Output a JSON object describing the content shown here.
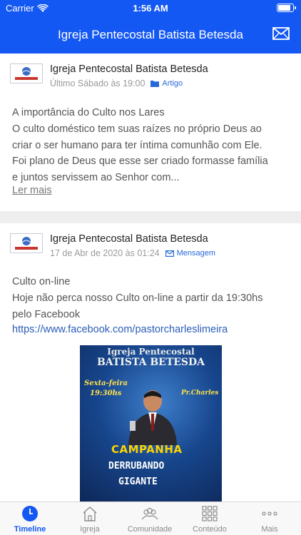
{
  "status_bar": {
    "carrier": "Carrier",
    "time": "1:56 AM",
    "battery_level": 0.9
  },
  "nav": {
    "title": "Igreja Pentecostal Batista Betesda",
    "mail_icon": "mail-icon"
  },
  "colors": {
    "brand": "#1458f3",
    "link": "#2a5db8",
    "tag": "#2768d8",
    "poster_yellow": "#ffd400"
  },
  "posts": [
    {
      "author": "Igreja Pentecostal Batista Betesda",
      "date": "Último Sábado às 19:00",
      "tag": "Artigo",
      "tag_icon": "folder-icon",
      "title": "A importância do Culto nos Lares",
      "lines": [
        "O culto doméstico tem suas raízes no próprio Deus ao",
        "criar o ser humano para ter íntima comunhão com Ele.",
        "Foi plano de Deus que esse ser criado formasse família",
        "e juntos servissem ao Senhor com..."
      ],
      "read_more": "Ler mais"
    },
    {
      "author": "Igreja Pentecostal Batista Betesda",
      "date": "17 de Abr de 2020 às 01:24",
      "tag": "Mensagem",
      "tag_icon": "envelope-icon",
      "title": "Culto on-line",
      "lines": [
        "Hoje não perca nosso Culto on-line a partir da 19:30hs",
        "pelo Facebook"
      ],
      "link": "https://www.facebook.com/pastorcharleslimeira",
      "poster": {
        "line1": "Igreja Pentecostal",
        "line2": "BATISTA BETESDA",
        "day": "Sexta-feira",
        "time": "19:30hs",
        "pastor": "Pr.Charles",
        "campaign": "CAMPANHA",
        "slogan1": "DERRUBANDO",
        "slogan2": "GIGANTE"
      }
    }
  ],
  "tabs": [
    {
      "label": "Timeline",
      "icon": "clock-icon",
      "active": true
    },
    {
      "label": "Igreja",
      "icon": "church-icon",
      "active": false
    },
    {
      "label": "Comunidade",
      "icon": "people-icon",
      "active": false
    },
    {
      "label": "Conteúdo",
      "icon": "grid-icon",
      "active": false
    },
    {
      "label": "Mais",
      "icon": "more-icon",
      "active": false
    }
  ]
}
